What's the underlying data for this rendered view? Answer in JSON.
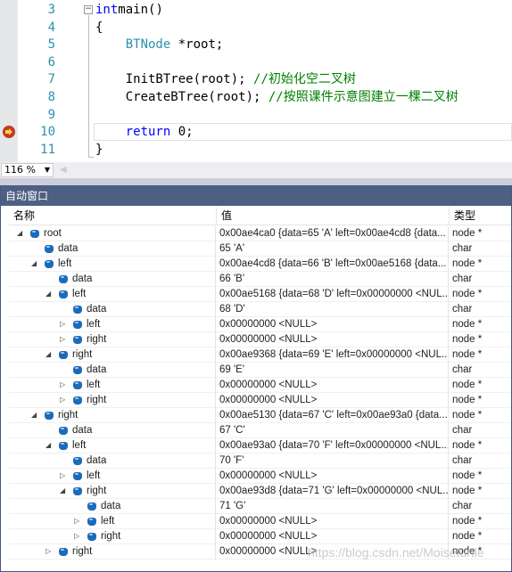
{
  "editor": {
    "lines": [
      {
        "n": "3",
        "parts": [
          [
            "kw",
            "int"
          ],
          [
            "",
            "main()"
          ]
        ]
      },
      {
        "n": "4",
        "parts": [
          [
            "",
            "{"
          ]
        ]
      },
      {
        "n": "5",
        "parts": [
          [
            "",
            "    "
          ],
          [
            "ty",
            "BTNode"
          ],
          [
            "",
            " *root;"
          ]
        ]
      },
      {
        "n": "6",
        "parts": []
      },
      {
        "n": "7",
        "parts": [
          [
            "",
            "    InitBTree(root); "
          ],
          [
            "cm",
            "//初始化空二叉树"
          ]
        ]
      },
      {
        "n": "8",
        "parts": [
          [
            "",
            "    CreateBTree(root); "
          ],
          [
            "cm",
            "//按照课件示意图建立一棵二叉树"
          ]
        ]
      },
      {
        "n": "9",
        "parts": []
      },
      {
        "n": "10",
        "parts": [
          [
            "",
            "    "
          ],
          [
            "kw",
            "return"
          ],
          [
            "",
            " 0;"
          ]
        ]
      },
      {
        "n": "11",
        "parts": [
          [
            "",
            "}"
          ]
        ]
      }
    ],
    "current_line": "10",
    "zoom": "116 %"
  },
  "autos": {
    "title": "自动窗口",
    "headers": {
      "name": "名称",
      "value": "值",
      "type": "类型"
    },
    "rows": [
      {
        "level": 0,
        "exp": "open",
        "name": "root",
        "value": "0x00ae4ca0 {data=65 'A' left=0x00ae4cd8 {data...",
        "type": "node *"
      },
      {
        "level": 1,
        "exp": "none",
        "name": "data",
        "value": "65 'A'",
        "type": "char"
      },
      {
        "level": 1,
        "exp": "open",
        "name": "left",
        "value": "0x00ae4cd8 {data=66 'B' left=0x00ae5168 {data...",
        "type": "node *"
      },
      {
        "level": 2,
        "exp": "none",
        "name": "data",
        "value": "66 'B'",
        "type": "char"
      },
      {
        "level": 2,
        "exp": "open",
        "name": "left",
        "value": "0x00ae5168 {data=68 'D' left=0x00000000 <NUL...",
        "type": "node *"
      },
      {
        "level": 3,
        "exp": "none",
        "name": "data",
        "value": "68 'D'",
        "type": "char"
      },
      {
        "level": 3,
        "exp": "closed",
        "name": "left",
        "value": "0x00000000 <NULL>",
        "type": "node *"
      },
      {
        "level": 3,
        "exp": "closed",
        "name": "right",
        "value": "0x00000000 <NULL>",
        "type": "node *"
      },
      {
        "level": 2,
        "exp": "open",
        "name": "right",
        "value": "0x00ae9368 {data=69 'E' left=0x00000000 <NUL...",
        "type": "node *"
      },
      {
        "level": 3,
        "exp": "none",
        "name": "data",
        "value": "69 'E'",
        "type": "char"
      },
      {
        "level": 3,
        "exp": "closed",
        "name": "left",
        "value": "0x00000000 <NULL>",
        "type": "node *"
      },
      {
        "level": 3,
        "exp": "closed",
        "name": "right",
        "value": "0x00000000 <NULL>",
        "type": "node *"
      },
      {
        "level": 1,
        "exp": "open",
        "name": "right",
        "value": "0x00ae5130 {data=67 'C' left=0x00ae93a0 {data...",
        "type": "node *"
      },
      {
        "level": 2,
        "exp": "none",
        "name": "data",
        "value": "67 'C'",
        "type": "char"
      },
      {
        "level": 2,
        "exp": "open",
        "name": "left",
        "value": "0x00ae93a0 {data=70 'F' left=0x00000000 <NUL...",
        "type": "node *"
      },
      {
        "level": 3,
        "exp": "none",
        "name": "data",
        "value": "70 'F'",
        "type": "char"
      },
      {
        "level": 3,
        "exp": "closed",
        "name": "left",
        "value": "0x00000000 <NULL>",
        "type": "node *"
      },
      {
        "level": 3,
        "exp": "open",
        "name": "right",
        "value": "0x00ae93d8 {data=71 'G' left=0x00000000 <NUL...",
        "type": "node *"
      },
      {
        "level": 4,
        "exp": "none",
        "name": "data",
        "value": "71 'G'",
        "type": "char"
      },
      {
        "level": 4,
        "exp": "closed",
        "name": "left",
        "value": "0x00000000 <NULL>",
        "type": "node *"
      },
      {
        "level": 4,
        "exp": "closed",
        "name": "right",
        "value": "0x00000000 <NULL>",
        "type": "node *"
      },
      {
        "level": 2,
        "exp": "closed",
        "name": "right",
        "value": "0x00000000 <NULL>",
        "type": "node *"
      }
    ]
  },
  "watermark": "https://blog.csdn.net/Moiseturtle"
}
